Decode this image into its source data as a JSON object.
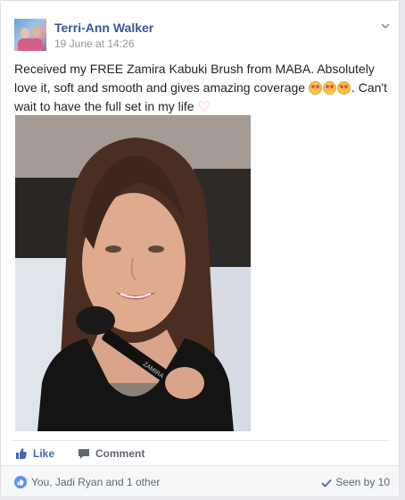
{
  "post": {
    "author": "Terri-Ann Walker",
    "timestamp": "19 June at 14:26",
    "text_part1": "Received my FREE Zamira Kabuki Brush from MABA. Absolutely love it, soft and smooth and gives amazing coverage ",
    "text_part2": ". Can't wait to have the full set in my life ",
    "photo_brush_label": "ZAMIRA"
  },
  "actions": {
    "like_label": "Like",
    "comment_label": "Comment"
  },
  "footer": {
    "likes_text": "You, Jadi Ryan and 1 other",
    "seen_text": "Seen by 10"
  },
  "icons": {
    "options": "chevron-down-icon",
    "like": "thumbs-up-icon",
    "comment": "comment-bubble-icon",
    "seen": "checkmark-icon",
    "emoji": "heart-eyes-emoji-icon",
    "heart": "heart-emoji-icon"
  },
  "colors": {
    "name_link": "#365899",
    "like_blue": "#4267b2",
    "meta_gray": "#90949c"
  }
}
